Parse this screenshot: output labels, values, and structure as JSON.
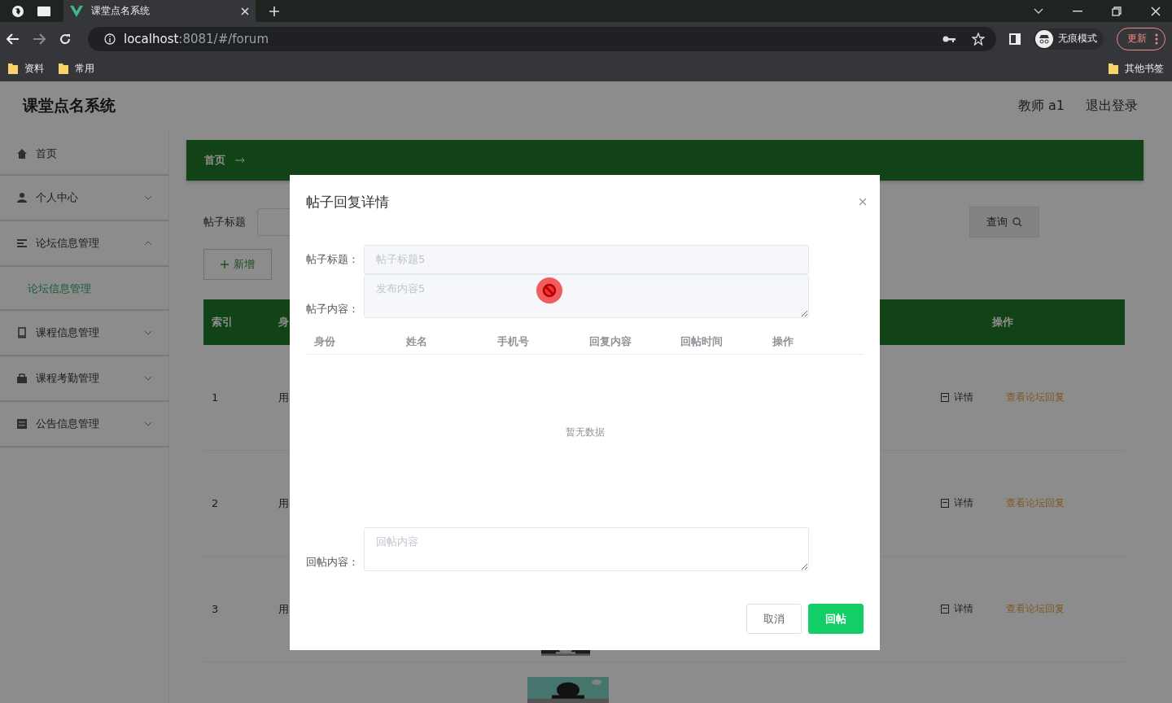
{
  "browser": {
    "tab_title": "课堂点名系统",
    "url_host": "localhost",
    "url_rest": ":8081/#/forum",
    "incognito_label": "无痕模式",
    "update_label": "更新",
    "bookmarks": [
      "资料",
      "常用"
    ],
    "other_bookmarks": "其他书签"
  },
  "app": {
    "title": "课堂点名系统",
    "user": "教师 a1",
    "logout": "退出登录"
  },
  "sidebar": {
    "items": [
      {
        "label": "首页",
        "kind": "link"
      },
      {
        "label": "个人中心",
        "kind": "group",
        "expanded": false
      },
      {
        "label": "论坛信息管理",
        "kind": "group",
        "expanded": true,
        "children": [
          {
            "label": "论坛信息管理",
            "selected": true
          }
        ]
      },
      {
        "label": "课程信息管理",
        "kind": "group",
        "expanded": false
      },
      {
        "label": "课程考勤管理",
        "kind": "group",
        "expanded": false
      },
      {
        "label": "公告信息管理",
        "kind": "group",
        "expanded": false
      }
    ]
  },
  "breadcrumb": [
    "首页"
  ],
  "search": {
    "label": "帖子标题",
    "button": "查询"
  },
  "add_button": "新增",
  "table": {
    "columns": [
      "索引",
      "身",
      "操作"
    ],
    "rows": [
      {
        "index": "1",
        "column_2": "用",
        "actions": [
          "详情",
          "查看论坛回复"
        ]
      },
      {
        "index": "2",
        "column_2": "用",
        "actions": [
          "详情",
          "查看论坛回复"
        ]
      },
      {
        "index": "3",
        "column_2": "用",
        "actions": [
          "详情",
          "查看论坛回复"
        ]
      }
    ]
  },
  "dialog": {
    "title": "帖子回复详情",
    "fields": [
      {
        "label": "帖子标题：",
        "kind": "input",
        "value": "帖子标题5",
        "disabled": true
      },
      {
        "label": "帖子内容：",
        "kind": "textarea",
        "value": "发布内容5",
        "disabled": true
      }
    ],
    "reply_table": {
      "columns": [
        "身份",
        "姓名",
        "手机号",
        "回复内容",
        "回帖时间",
        "操作"
      ],
      "empty_text": "暂无数据"
    },
    "reply_field": {
      "label": "回帖内容：",
      "placeholder": "回帖内容"
    },
    "buttons": [
      {
        "label": "取消",
        "kind": "default"
      },
      {
        "label": "回帖",
        "kind": "primary"
      }
    ]
  }
}
